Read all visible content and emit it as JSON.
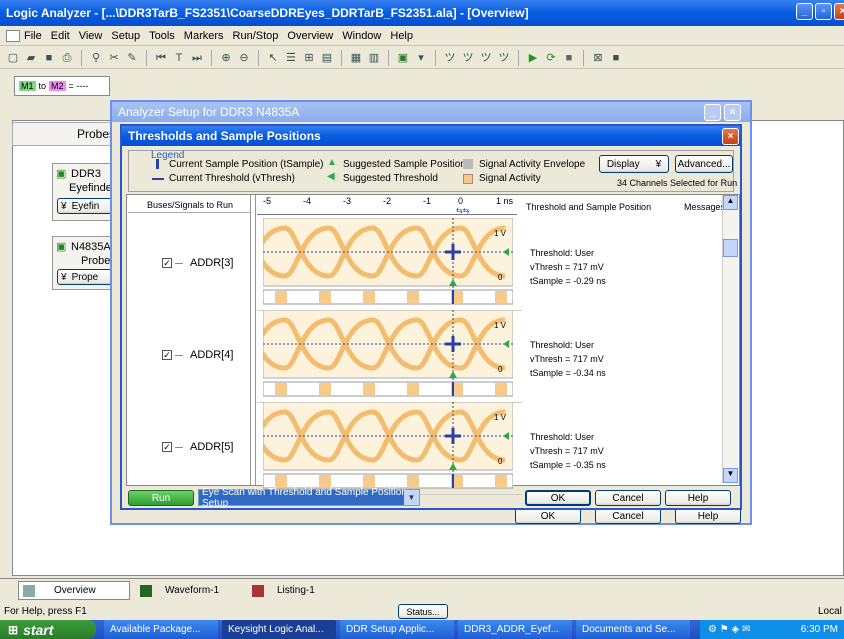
{
  "app": {
    "title": "Logic Analyzer - [...\\DDR3TarB_FS2351\\CoarseDDREyes_DDRTarB_FS2351.ala] - [Overview]"
  },
  "menu": [
    "File",
    "Edit",
    "View",
    "Setup",
    "Tools",
    "Markers",
    "Run/Stop",
    "Overview",
    "Window",
    "Help"
  ],
  "marker_bar": {
    "m1": "M1",
    "to": "to",
    "m2": "M2",
    "eq": "= ----"
  },
  "left_panel": {
    "probes_label": "Probes",
    "ddr3_module": "DDR3",
    "ddr3_sub": "Eyefinde",
    "ddr3_btn": "Eyefin",
    "n4835_module": "N4835A",
    "n4835_sub": "Probe",
    "n4835_btn": "Prope"
  },
  "setup_window": {
    "title": "Analyzer Setup for DDR3 N4835A",
    "ok": "OK",
    "cancel": "Cancel",
    "help": "Help"
  },
  "dialog": {
    "title": "Thresholds and Sample Positions",
    "legend": {
      "title": "Legend",
      "current_sample": "Current Sample Position (tSample)",
      "current_threshold": "Current Threshold (vThresh)",
      "suggested_sample": "Suggested Sample Position",
      "suggested_threshold": "Suggested Threshold",
      "activity_envelope": "Signal Activity Envelope",
      "signal_activity": "Signal Activity"
    },
    "display_btn": "Display",
    "advanced_btn": "Advanced...",
    "channels_info": "34 Channels Selected for Run",
    "col_buses": "Buses/Signals to Run",
    "col_tsp": "Threshold and Sample Position",
    "col_messages": "Messages",
    "axis_ticks": [
      "-5",
      "-4",
      "-3",
      "-2",
      "-1",
      "0",
      "1 ns"
    ],
    "signals": [
      {
        "name": "ADDR[3]",
        "vlabel_top": "1 V",
        "vlabel_bot": "0",
        "threshold_label": "Threshold: User",
        "vthresh": "vThresh =   717 mV",
        "tsample": "tSample = -0.29 ns"
      },
      {
        "name": "ADDR[4]",
        "vlabel_top": "1 V",
        "vlabel_bot": "0",
        "threshold_label": "Threshold: User",
        "vthresh": "vThresh =   717 mV",
        "tsample": "tSample = -0.34 ns"
      },
      {
        "name": "ADDR[5]",
        "vlabel_top": "1 V",
        "vlabel_bot": "0",
        "threshold_label": "Threshold: User",
        "vthresh": "vThresh =   717 mV",
        "tsample": "tSample = -0.35 ns"
      }
    ],
    "run_btn": "Run",
    "mode_select": "Eye Scan with Threshold and Sample Position Setup",
    "ok": "OK",
    "cancel": "Cancel",
    "help": "Help"
  },
  "tabs": [
    "Overview",
    "Waveform-1",
    "Listing-1"
  ],
  "status": {
    "help": "For Help, press F1",
    "status_btn": "Status...",
    "right": "Local"
  },
  "taskbar": {
    "start": "start",
    "items": [
      "Available Package...",
      "Keysight Logic Anal...",
      "DDR Setup Applic...",
      "DDR3_ADDR_Eyef...",
      "Documents and Se..."
    ],
    "clock": "6:30 PM"
  },
  "colors": {
    "eye": "#f2b35c",
    "threshold": "#2a3fa8",
    "suggested": "#2aa84a",
    "activity": "#f7c98a"
  }
}
